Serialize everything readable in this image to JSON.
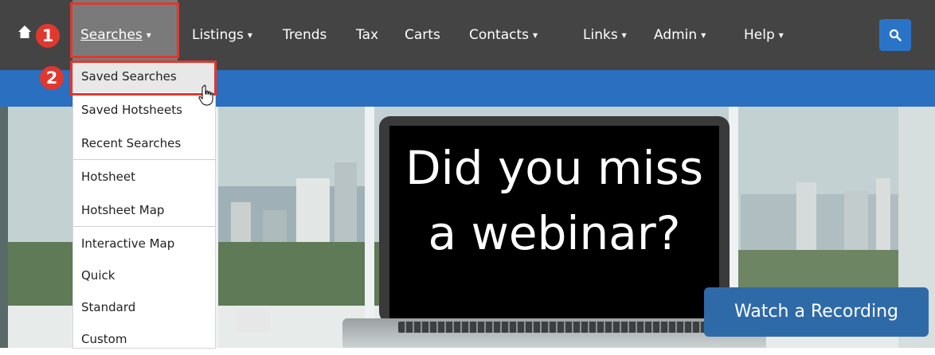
{
  "nav": {
    "items": [
      {
        "label": "Searches",
        "caret": "▾"
      },
      {
        "label": "Listings",
        "caret": "▾"
      },
      {
        "label": "Trends",
        "caret": ""
      },
      {
        "label": "Tax",
        "caret": ""
      },
      {
        "label": "Carts",
        "caret": ""
      },
      {
        "label": "Contacts",
        "caret": "▾"
      },
      {
        "label": "Links",
        "caret": "▾"
      },
      {
        "label": "Admin",
        "caret": "▾"
      },
      {
        "label": "Help",
        "caret": "▾"
      }
    ],
    "home_icon": "home-icon",
    "search_icon": "search-icon"
  },
  "dropdown": {
    "items": [
      "Saved Searches",
      "Saved Hotsheets",
      "Recent Searches",
      "Hotsheet",
      "Hotsheet Map",
      "Interactive Map",
      "Quick",
      "Standard",
      "Custom"
    ]
  },
  "hero": {
    "line1": "Did you miss",
    "line2": "a webinar?",
    "button": "Watch a Recording"
  },
  "annotations": {
    "badge1": "1",
    "badge2": "2",
    "color": "#e0382f"
  },
  "colors": {
    "nav_bg": "#444444",
    "accent_blue": "#2a6fc0",
    "button_blue": "#2f6aa8"
  }
}
